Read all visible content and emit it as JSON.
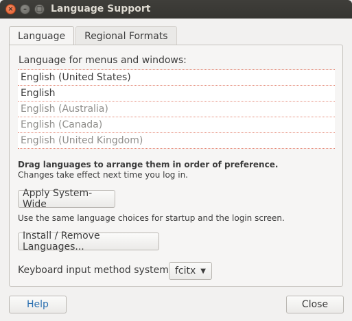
{
  "window": {
    "title": "Language Support",
    "close_glyph": "×",
    "min_glyph": "–",
    "max_glyph": "□"
  },
  "tabs": [
    {
      "label": "Language",
      "active": true
    },
    {
      "label": "Regional Formats",
      "active": false
    }
  ],
  "language_panel": {
    "heading": "Language for menus and windows:",
    "languages": [
      {
        "label": "English (United States)",
        "state": "active"
      },
      {
        "label": "English",
        "state": "active"
      },
      {
        "label": "English (Australia)",
        "state": "inactive"
      },
      {
        "label": "English (Canada)",
        "state": "inactive"
      },
      {
        "label": "English (United Kingdom)",
        "state": "inactive"
      }
    ],
    "hint_bold": "Drag languages to arrange them in order of preference.",
    "hint": "Changes take effect next time you log in.",
    "apply_button": "Apply System-Wide",
    "apply_hint": "Use the same language choices for startup and the login screen.",
    "install_button": "Install / Remove Languages...",
    "keyboard_label": "Keyboard input method system:",
    "keyboard_value": "fcitx"
  },
  "footer": {
    "help_button": "Help",
    "close_button": "Close"
  },
  "colors": {
    "titlebar": "#3a3935",
    "close_button": "#e5572b",
    "separator": "#e48a78",
    "help_text": "#2a6fb0"
  }
}
